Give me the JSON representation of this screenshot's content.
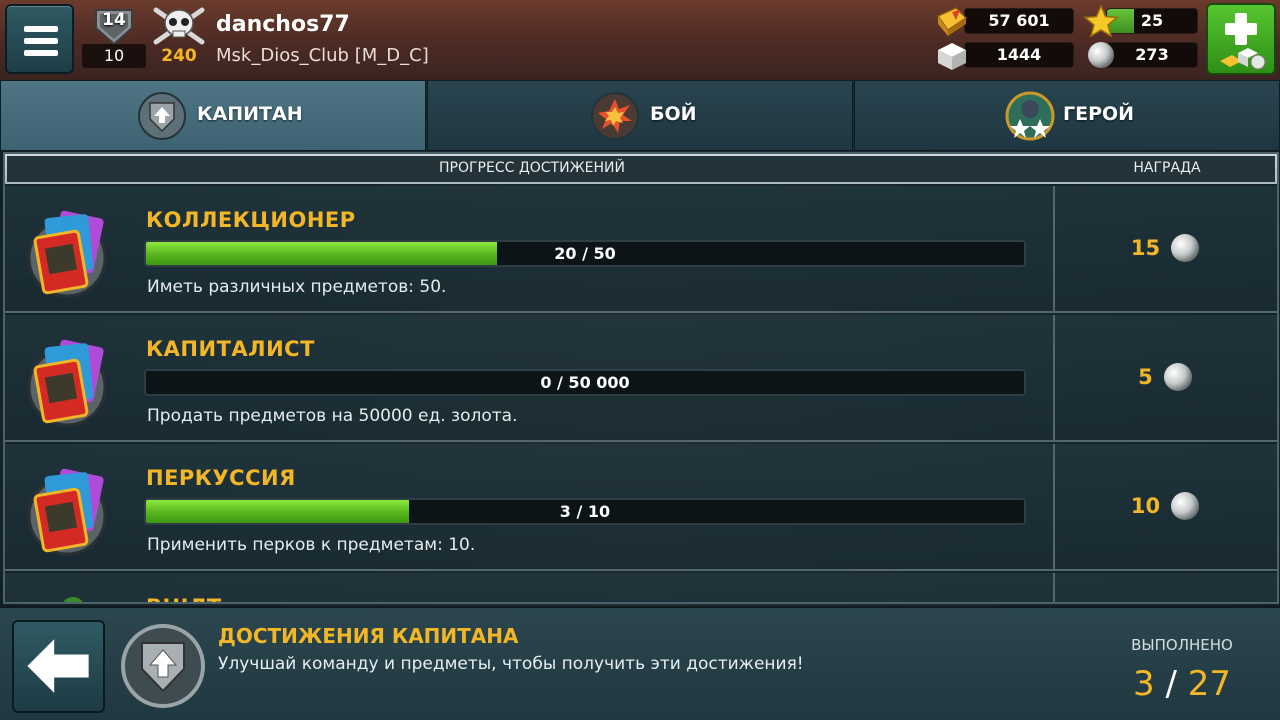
{
  "player": {
    "rank": "14",
    "level": "10",
    "skull_count": "240",
    "username": "danchos77",
    "clan": "Msk_Dios_Club [M_D_C]"
  },
  "resources": {
    "gold": "57 601",
    "gems": "1444",
    "stars": "25",
    "xp_fraction": 0.3,
    "pearls": "273"
  },
  "tabs": [
    {
      "label": "КАПИТАН",
      "icon": "captain-upgrade-icon",
      "active": true
    },
    {
      "label": "БОЙ",
      "icon": "battle-explosion-icon",
      "active": false
    },
    {
      "label": "ГЕРОЙ",
      "icon": "hero-stars-icon",
      "active": false
    }
  ],
  "table": {
    "header_progress": "ПРОГРЕСС ДОСТИЖЕНИЙ",
    "header_reward": "НАГРАДА",
    "rows": [
      {
        "title": "КОЛЛЕКЦИОНЕР",
        "progress_text": "20 / 50",
        "progress": 0.4,
        "desc": "Иметь различных предметов: 50.",
        "reward": "15"
      },
      {
        "title": "КАПИТАЛИСТ",
        "progress_text": "0 / 50 000",
        "progress": 0.0,
        "desc": "Продать предметов на 50000 ед. золота.",
        "reward": "5"
      },
      {
        "title": "ПЕРКУССИЯ",
        "progress_text": "3 / 10",
        "progress": 0.3,
        "desc": "Применить перков к предметам: 10.",
        "reward": "10"
      },
      {
        "title": "ВНІЛТ",
        "progress_text": "",
        "progress": 0.0,
        "desc": "",
        "reward": ""
      }
    ]
  },
  "footer": {
    "title": "ДОСТИЖЕНИЯ КАПИТАНА",
    "desc": "Улучшай команду и предметы, чтобы получить эти достижения!",
    "done_label": "ВЫПОЛНЕНО",
    "done_count": "3",
    "total_count": "27"
  },
  "colors": {
    "accent_gold": "#f2b627",
    "progress_green": "#57b61d",
    "tab_active": "#4f7585"
  }
}
